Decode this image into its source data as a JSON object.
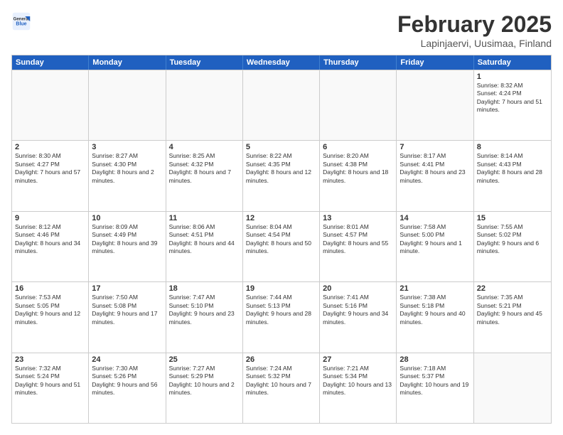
{
  "header": {
    "logo": {
      "general": "General",
      "blue": "Blue"
    },
    "month": "February 2025",
    "location": "Lapinjaervi, Uusimaa, Finland"
  },
  "weekdays": [
    "Sunday",
    "Monday",
    "Tuesday",
    "Wednesday",
    "Thursday",
    "Friday",
    "Saturday"
  ],
  "weeks": [
    [
      {
        "day": "",
        "info": ""
      },
      {
        "day": "",
        "info": ""
      },
      {
        "day": "",
        "info": ""
      },
      {
        "day": "",
        "info": ""
      },
      {
        "day": "",
        "info": ""
      },
      {
        "day": "",
        "info": ""
      },
      {
        "day": "1",
        "info": "Sunrise: 8:32 AM\nSunset: 4:24 PM\nDaylight: 7 hours and 51 minutes."
      }
    ],
    [
      {
        "day": "2",
        "info": "Sunrise: 8:30 AM\nSunset: 4:27 PM\nDaylight: 7 hours and 57 minutes."
      },
      {
        "day": "3",
        "info": "Sunrise: 8:27 AM\nSunset: 4:30 PM\nDaylight: 8 hours and 2 minutes."
      },
      {
        "day": "4",
        "info": "Sunrise: 8:25 AM\nSunset: 4:32 PM\nDaylight: 8 hours and 7 minutes."
      },
      {
        "day": "5",
        "info": "Sunrise: 8:22 AM\nSunset: 4:35 PM\nDaylight: 8 hours and 12 minutes."
      },
      {
        "day": "6",
        "info": "Sunrise: 8:20 AM\nSunset: 4:38 PM\nDaylight: 8 hours and 18 minutes."
      },
      {
        "day": "7",
        "info": "Sunrise: 8:17 AM\nSunset: 4:41 PM\nDaylight: 8 hours and 23 minutes."
      },
      {
        "day": "8",
        "info": "Sunrise: 8:14 AM\nSunset: 4:43 PM\nDaylight: 8 hours and 28 minutes."
      }
    ],
    [
      {
        "day": "9",
        "info": "Sunrise: 8:12 AM\nSunset: 4:46 PM\nDaylight: 8 hours and 34 minutes."
      },
      {
        "day": "10",
        "info": "Sunrise: 8:09 AM\nSunset: 4:49 PM\nDaylight: 8 hours and 39 minutes."
      },
      {
        "day": "11",
        "info": "Sunrise: 8:06 AM\nSunset: 4:51 PM\nDaylight: 8 hours and 44 minutes."
      },
      {
        "day": "12",
        "info": "Sunrise: 8:04 AM\nSunset: 4:54 PM\nDaylight: 8 hours and 50 minutes."
      },
      {
        "day": "13",
        "info": "Sunrise: 8:01 AM\nSunset: 4:57 PM\nDaylight: 8 hours and 55 minutes."
      },
      {
        "day": "14",
        "info": "Sunrise: 7:58 AM\nSunset: 5:00 PM\nDaylight: 9 hours and 1 minute."
      },
      {
        "day": "15",
        "info": "Sunrise: 7:55 AM\nSunset: 5:02 PM\nDaylight: 9 hours and 6 minutes."
      }
    ],
    [
      {
        "day": "16",
        "info": "Sunrise: 7:53 AM\nSunset: 5:05 PM\nDaylight: 9 hours and 12 minutes."
      },
      {
        "day": "17",
        "info": "Sunrise: 7:50 AM\nSunset: 5:08 PM\nDaylight: 9 hours and 17 minutes."
      },
      {
        "day": "18",
        "info": "Sunrise: 7:47 AM\nSunset: 5:10 PM\nDaylight: 9 hours and 23 minutes."
      },
      {
        "day": "19",
        "info": "Sunrise: 7:44 AM\nSunset: 5:13 PM\nDaylight: 9 hours and 28 minutes."
      },
      {
        "day": "20",
        "info": "Sunrise: 7:41 AM\nSunset: 5:16 PM\nDaylight: 9 hours and 34 minutes."
      },
      {
        "day": "21",
        "info": "Sunrise: 7:38 AM\nSunset: 5:18 PM\nDaylight: 9 hours and 40 minutes."
      },
      {
        "day": "22",
        "info": "Sunrise: 7:35 AM\nSunset: 5:21 PM\nDaylight: 9 hours and 45 minutes."
      }
    ],
    [
      {
        "day": "23",
        "info": "Sunrise: 7:32 AM\nSunset: 5:24 PM\nDaylight: 9 hours and 51 minutes."
      },
      {
        "day": "24",
        "info": "Sunrise: 7:30 AM\nSunset: 5:26 PM\nDaylight: 9 hours and 56 minutes."
      },
      {
        "day": "25",
        "info": "Sunrise: 7:27 AM\nSunset: 5:29 PM\nDaylight: 10 hours and 2 minutes."
      },
      {
        "day": "26",
        "info": "Sunrise: 7:24 AM\nSunset: 5:32 PM\nDaylight: 10 hours and 7 minutes."
      },
      {
        "day": "27",
        "info": "Sunrise: 7:21 AM\nSunset: 5:34 PM\nDaylight: 10 hours and 13 minutes."
      },
      {
        "day": "28",
        "info": "Sunrise: 7:18 AM\nSunset: 5:37 PM\nDaylight: 10 hours and 19 minutes."
      },
      {
        "day": "",
        "info": ""
      }
    ]
  ]
}
